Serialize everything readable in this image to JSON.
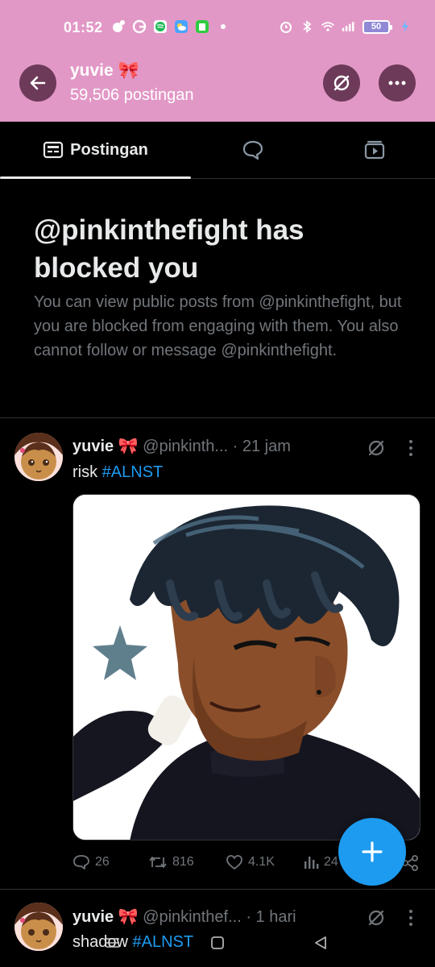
{
  "status_bar": {
    "time": "01:52",
    "battery": "50"
  },
  "header": {
    "name": "yuvie 🎀",
    "post_count": "59,506 postingan"
  },
  "tabs": [
    {
      "label": "Postingan"
    }
  ],
  "blocked": {
    "title": "@pinkinthefight has blocked you",
    "description": "You can view public posts from @pinkinthefight, but you are blocked from engaging with them. You also cannot follow or message @pinkinthefight."
  },
  "posts": [
    {
      "name": "yuvie 🎀",
      "handle": "@pinkinth...",
      "time": "· 21 jam",
      "text": "risk",
      "hashtag": "#ALNST",
      "replies": "26",
      "reposts": "816",
      "likes": "4.1K",
      "views": "24"
    },
    {
      "name": "yuvie 🎀",
      "handle": "@pinkinthef...",
      "time": "· 1 hari",
      "text": "shadow",
      "hashtag": "#ALNST"
    }
  ],
  "colors": {
    "header_bg": "#e298c6",
    "header_button": "#6d3a59",
    "accent": "#1d9bf0",
    "background": "#000000",
    "muted_text": "#71767b"
  },
  "icons": {
    "back": "arrow-left-icon",
    "repost_off": "repost-off-icon",
    "more": "more-horizontal-icon",
    "posts_tab": "article-icon",
    "replies_tab": "chat-bubble-icon",
    "media_tab": "media-play-icon",
    "compose": "plus-icon"
  }
}
